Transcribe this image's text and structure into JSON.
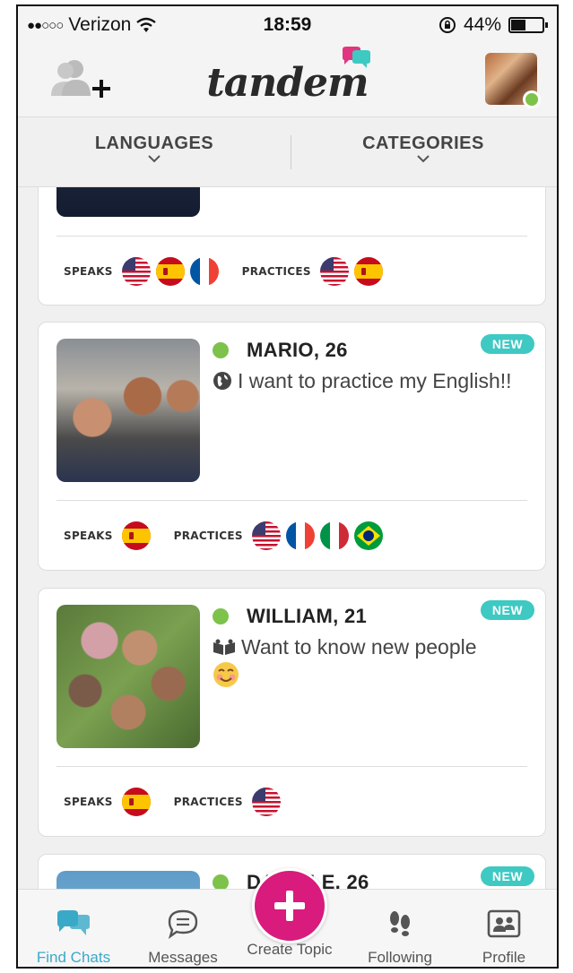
{
  "status_bar": {
    "carrier": "Verizon",
    "time": "18:59",
    "battery": "44%",
    "battery_level": 0.44
  },
  "header": {
    "logo": "tandem"
  },
  "filters": {
    "languages": "LANGUAGES",
    "categories": "CATEGORIES"
  },
  "labels": {
    "speaks": "SPEAKS",
    "practices": "PRACTICES",
    "new_badge": "NEW"
  },
  "cards": [
    {
      "name": "",
      "speaks": [
        "us",
        "es",
        "fr"
      ],
      "practices": [
        "us",
        "es"
      ]
    },
    {
      "name": "MARIO, 26",
      "topic_icon": "globe-icon",
      "topic": "I want to practice my English!!",
      "is_new": true,
      "speaks": [
        "es"
      ],
      "practices": [
        "us",
        "fr",
        "it",
        "br"
      ]
    },
    {
      "name": "WILLIAM, 21",
      "topic_icon": "people-icon",
      "topic": "Want to know new people",
      "topic_emoji": "smiling-emoji",
      "is_new": true,
      "speaks": [
        "es"
      ],
      "practices": [
        "us"
      ]
    },
    {
      "name": "DANIELE, 26",
      "is_new": true
    }
  ],
  "tabs": [
    {
      "label": "Find Chats",
      "icon": "chat-bubbles-icon",
      "active": true
    },
    {
      "label": "Messages",
      "icon": "message-icon",
      "active": false
    },
    {
      "label": "Create Topic",
      "icon": "plus-icon",
      "active": false
    },
    {
      "label": "Following",
      "icon": "footprints-icon",
      "active": false
    },
    {
      "label": "Profile",
      "icon": "profile-card-icon",
      "active": false
    }
  ],
  "colors": {
    "accent_teal": "#3ec9c3",
    "create_pink": "#d81b7d",
    "online_green": "#7dc24b",
    "active_tab": "#3aa9c8"
  }
}
